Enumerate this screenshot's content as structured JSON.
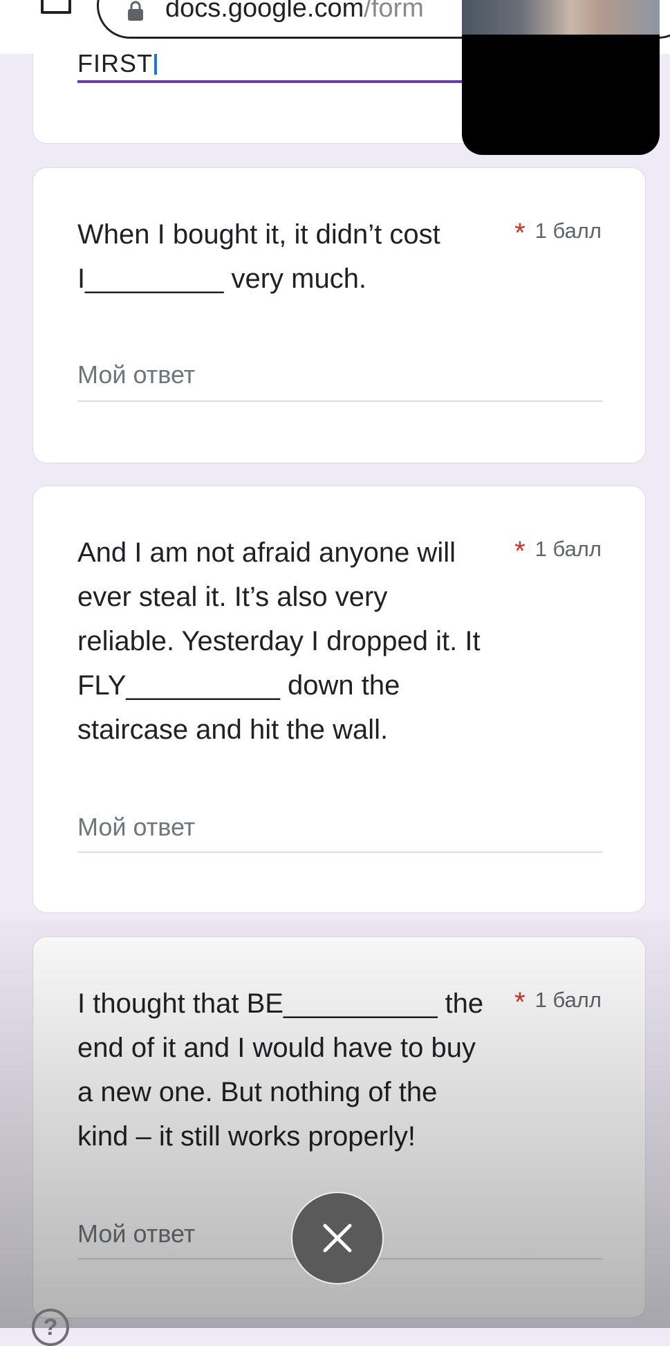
{
  "browser": {
    "url_domain": "docs.google.com",
    "url_path": "/form"
  },
  "top_answer": {
    "value": "FIRST"
  },
  "questions": [
    {
      "text": "When I bought it, it didn’t cost\nI_________ very much.",
      "required_mark": "*",
      "points": "1 балл",
      "answer_placeholder": "Мой ответ"
    },
    {
      "text": "And I am not afraid anyone will\never steal it.  It’s also very\nreliable. Yesterday I dropped it. It\nFLY__________ down the\nstaircase and hit the wall.",
      "required_mark": "*",
      "points": "1 балл",
      "answer_placeholder": "Мой ответ"
    },
    {
      "text": "I thought that BE__________ the\nend of it and I would have to buy\na new one. But nothing of the\nkind – it still works properly!",
      "required_mark": "*",
      "points": "1 балл",
      "answer_placeholder": "Мой ответ"
    }
  ],
  "help": {
    "glyph": "?"
  },
  "icons": [
    "home-icon",
    "lock-icon",
    "close-icon",
    "help-icon"
  ],
  "colors": {
    "page_bg": "#eeebf7",
    "accent_underline": "#673ab7",
    "caret": "#1a73e8",
    "required_star": "#d93025",
    "fab_bg": "#5a5a5a"
  }
}
